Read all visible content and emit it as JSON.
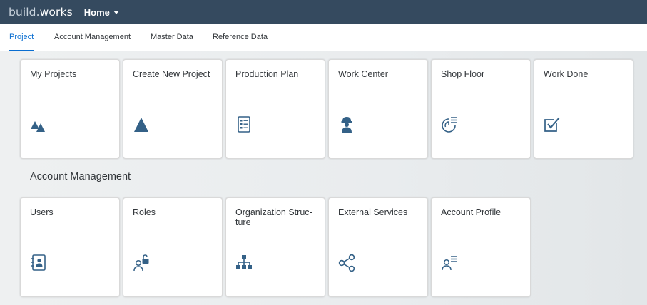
{
  "app": {
    "brand_part1": "build",
    "brand_dot": ".",
    "brand_part2": "works",
    "menu_label": "Home"
  },
  "tabs": [
    {
      "label": "Project"
    },
    {
      "label": "Account Management"
    },
    {
      "label": "Master Data"
    },
    {
      "label": "Reference Data"
    }
  ],
  "project_tiles": [
    {
      "title": "My Projects",
      "icon": "mountains-icon"
    },
    {
      "title": "Create New Project",
      "icon": "triangle-icon"
    },
    {
      "title": "Production Plan",
      "icon": "checklist-icon"
    },
    {
      "title": "Work Center",
      "icon": "worker-icon"
    },
    {
      "title": "Shop Floor",
      "icon": "pie-list-icon"
    },
    {
      "title": "Work Done",
      "icon": "checkbox-icon"
    }
  ],
  "account_section": {
    "title": "Account Management",
    "tiles": [
      {
        "title": "Users",
        "icon": "address-book-icon"
      },
      {
        "title": "Roles",
        "icon": "user-lock-icon"
      },
      {
        "title": "Organization Struc-ture",
        "icon": "org-chart-icon"
      },
      {
        "title": "External Services",
        "icon": "share-icon"
      },
      {
        "title": "Account Profile",
        "icon": "user-list-icon"
      }
    ]
  },
  "colors": {
    "shellbar": "#354a5f",
    "accent": "#0a6ed1",
    "icon": "#346187"
  }
}
